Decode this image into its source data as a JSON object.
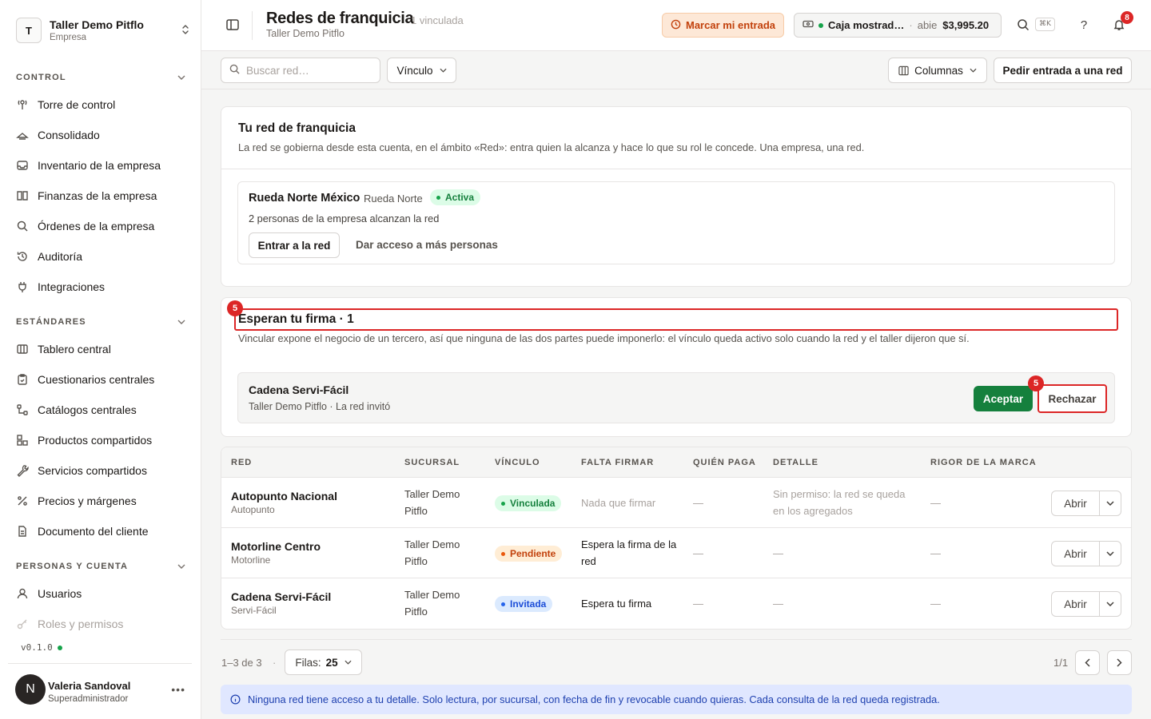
{
  "org": {
    "initial": "T",
    "name": "Taller Demo Pitflo",
    "type": "Empresa"
  },
  "nav": {
    "sections": [
      {
        "title": "CONTROL",
        "items": [
          {
            "label": "Torre de control",
            "icon": "tower-icon"
          },
          {
            "label": "Consolidado",
            "icon": "layers-icon"
          },
          {
            "label": "Inventario de la empresa",
            "icon": "inbox-icon"
          },
          {
            "label": "Finanzas de la empresa",
            "icon": "book-icon"
          },
          {
            "label": "Órdenes de la empresa",
            "icon": "search-icon"
          },
          {
            "label": "Auditoría",
            "icon": "history-icon"
          },
          {
            "label": "Integraciones",
            "icon": "plug-icon"
          }
        ]
      },
      {
        "title": "ESTÁNDARES",
        "items": [
          {
            "label": "Tablero central",
            "icon": "columns-icon"
          },
          {
            "label": "Cuestionarios centrales",
            "icon": "clipboard-icon"
          },
          {
            "label": "Catálogos centrales",
            "icon": "hierarchy-icon"
          },
          {
            "label": "Productos compartidos",
            "icon": "boxes-icon"
          },
          {
            "label": "Servicios compartidos",
            "icon": "wrench-icon"
          },
          {
            "label": "Precios y márgenes",
            "icon": "percent-icon"
          },
          {
            "label": "Documento del cliente",
            "icon": "document-icon"
          }
        ]
      },
      {
        "title": "PERSONAS Y CUENTA",
        "items": [
          {
            "label": "Usuarios",
            "icon": "user-icon"
          },
          {
            "label": "Roles y permisos",
            "icon": "key-icon"
          }
        ]
      }
    ]
  },
  "version": "v0.1.0",
  "user": {
    "initial": "N",
    "name": "Valeria Sandoval",
    "role": "Superadministrador"
  },
  "header": {
    "title": "Redes de franquicia",
    "count": "1 vinculada",
    "subtitle": "Taller Demo Pitflo",
    "entry_button": "Marcar mi entrada",
    "cash": {
      "name": "Caja mostrad…",
      "separator": "·",
      "status": "abie",
      "amount": "$3,995.20"
    },
    "shortcut": "⌘K",
    "notifications": "8"
  },
  "toolbar": {
    "search_placeholder": "Buscar red…",
    "filter_label": "Vínculo",
    "columns_label": "Columnas",
    "request_button": "Pedir entrada a una red"
  },
  "own_network": {
    "title": "Tu red de franquicia",
    "description": "La red se gobierna desde esta cuenta, en el ámbito «Red»: entra quien la alcanza y hace lo que su rol le concede. Una empresa, una red.",
    "name": "Rueda Norte México",
    "short": "Rueda Norte",
    "status": "Activa",
    "people": "2 personas de la empresa alcanzan la red",
    "enter_button": "Entrar a la red",
    "access_button": "Dar acceso a más personas"
  },
  "pending": {
    "marker": "5",
    "title": "Esperan tu firma · 1",
    "description": "Vincular expone el negocio de un tercero, así que ninguna de las dos partes puede imponerlo: el vínculo queda activo solo cuando la red y el taller dijeron que sí.",
    "item": {
      "name": "Cadena Servi-Fácil",
      "sub": "Taller Demo Pitflo · La red invitó"
    },
    "accept": "Aceptar",
    "reject": "Rechazar"
  },
  "table": {
    "columns": [
      "RED",
      "SUCURSAL",
      "VÍNCULO",
      "FALTA FIRMAR",
      "QUIÉN PAGA",
      "DETALLE",
      "RIGOR DE LA MARCA"
    ],
    "rows": [
      {
        "name": "Autopunto Nacional",
        "short": "Autopunto",
        "branch": "Taller Demo Pitflo",
        "link": "Vinculada",
        "pending": "Nada que firmar",
        "payer": "—",
        "detail": "Sin permiso: la red se queda en los agregados",
        "rigor": "—",
        "action": "Abrir"
      },
      {
        "name": "Motorline Centro",
        "short": "Motorline",
        "branch": "Taller Demo Pitflo",
        "link": "Pendiente",
        "pending": "Espera la firma de la red",
        "payer": "—",
        "detail": "—",
        "rigor": "—",
        "action": "Abrir"
      },
      {
        "name": "Cadena Servi-Fácil",
        "short": "Servi-Fácil",
        "branch": "Taller Demo Pitflo",
        "link": "Invitada",
        "pending": "Espera tu firma",
        "payer": "—",
        "detail": "—",
        "rigor": "—",
        "action": "Abrir"
      }
    ]
  },
  "pagination": {
    "range": "1–3 de 3",
    "sep": "·",
    "rows_label": "Filas:",
    "rows_value": "25",
    "page": "1/1"
  },
  "notice": "Ninguna red tiene acceso a tu detalle. Solo lectura, por sucursal, con fecha de fin y revocable cuando quieras. Cada consulta de la red queda registrada.",
  "colors": {
    "accent_green": "#15803d",
    "warning_orange": "#c2410c",
    "highlight_red": "#dc2626",
    "info_blue": "#1e40af"
  }
}
